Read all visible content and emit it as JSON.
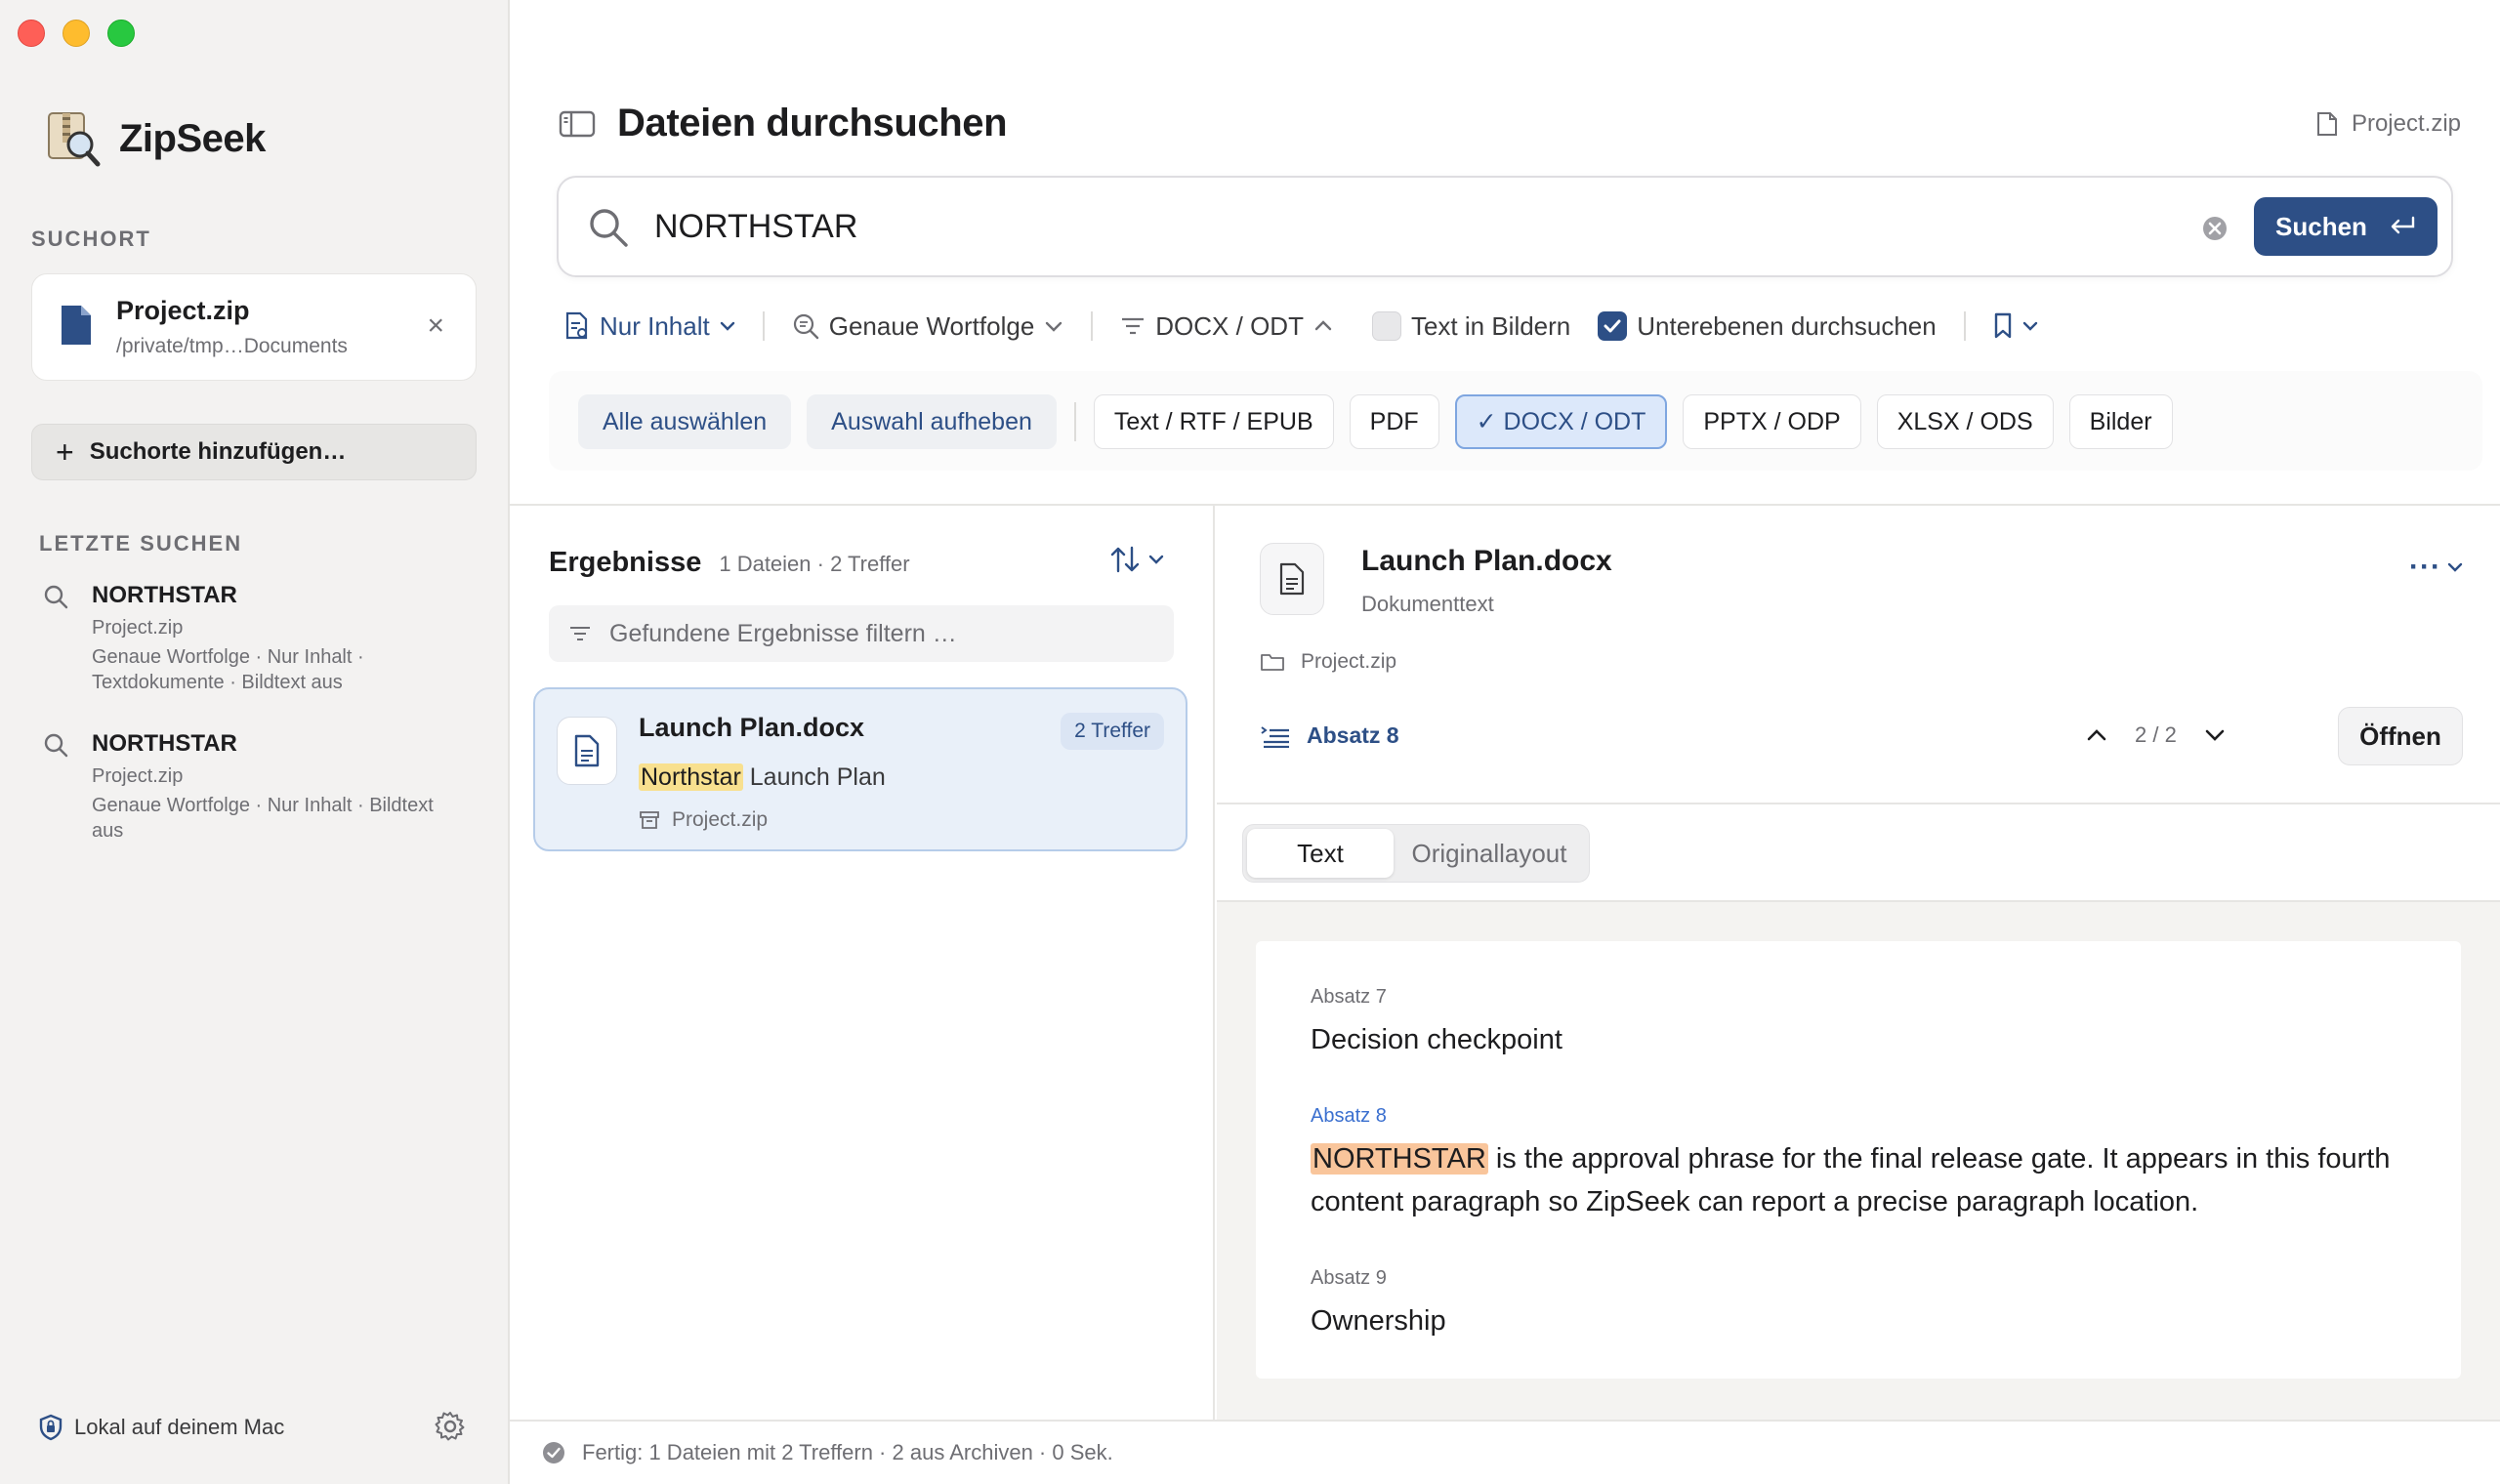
{
  "app": {
    "name": "ZipSeek"
  },
  "sidebar": {
    "search_location_label": "SUCHORT",
    "location": {
      "name": "Project.zip",
      "path": "/private/tmp…Documents"
    },
    "add_location_label": "Suchorte hinzufügen…",
    "recent_label": "LETZTE SUCHEN",
    "recent": [
      {
        "query": "NORTHSTAR",
        "source": "Project.zip",
        "desc": "Genaue Wortfolge · Nur Inhalt · Textdokumente · Bildtext aus"
      },
      {
        "query": "NORTHSTAR",
        "source": "Project.zip",
        "desc": "Genaue Wortfolge · Nur Inhalt · Bildtext aus"
      }
    ],
    "local_label": "Lokal auf deinem Mac"
  },
  "header": {
    "title": "Dateien durchsuchen",
    "file": "Project.zip"
  },
  "search": {
    "value": "NORTHSTAR",
    "button_label": "Suchen"
  },
  "filters": {
    "scope": "Nur Inhalt",
    "match": "Genaue Wortfolge",
    "types": "DOCX / ODT",
    "text_in_images": {
      "label": "Text in Bildern",
      "checked": false
    },
    "subfolders": {
      "label": "Unterebenen durchsuchen",
      "checked": true
    }
  },
  "chips": {
    "select_all": "Alle auswählen",
    "deselect": "Auswahl aufheben",
    "items": [
      {
        "label": "Text / RTF / EPUB",
        "active": false
      },
      {
        "label": "PDF",
        "active": false
      },
      {
        "label": "✓ DOCX / ODT",
        "active": true
      },
      {
        "label": "PPTX / ODP",
        "active": false
      },
      {
        "label": "XLSX / ODS",
        "active": false
      },
      {
        "label": "Bilder",
        "active": false
      }
    ]
  },
  "results": {
    "title": "Ergebnisse",
    "meta": "1 Dateien · 2 Treffer",
    "filter_placeholder": "Gefundene Ergebnisse filtern …",
    "items": [
      {
        "name": "Launch Plan.docx",
        "badge": "2 Treffer",
        "snippet_hit": "Northstar",
        "snippet_rest": " Launch Plan",
        "source": "Project.zip"
      }
    ]
  },
  "detail": {
    "name": "Launch Plan.docx",
    "type": "Dokumenttext",
    "path": "Project.zip",
    "paragraph": "Absatz 8",
    "nav": "2 / 2",
    "open_label": "Öffnen",
    "tabs": [
      "Text",
      "Originallayout"
    ],
    "preview": [
      {
        "label": "Absatz 7",
        "text": "Decision checkpoint"
      },
      {
        "label": "Absatz 8",
        "hit": "NORTHSTAR",
        "text": " is the approval phrase for the final release gate. It appears in this fourth content paragraph so ZipSeek can report a precise paragraph location."
      },
      {
        "label": "Absatz 9",
        "text": "Ownership"
      }
    ]
  },
  "status": {
    "text": "Fertig: 1 Dateien mit 2 Treffern · 2 aus Archiven · 0 Sek."
  },
  "colors": {
    "accent": "#2d4f86",
    "highlight_yellow": "#f8e08f",
    "highlight_orange": "#f9c59b"
  }
}
